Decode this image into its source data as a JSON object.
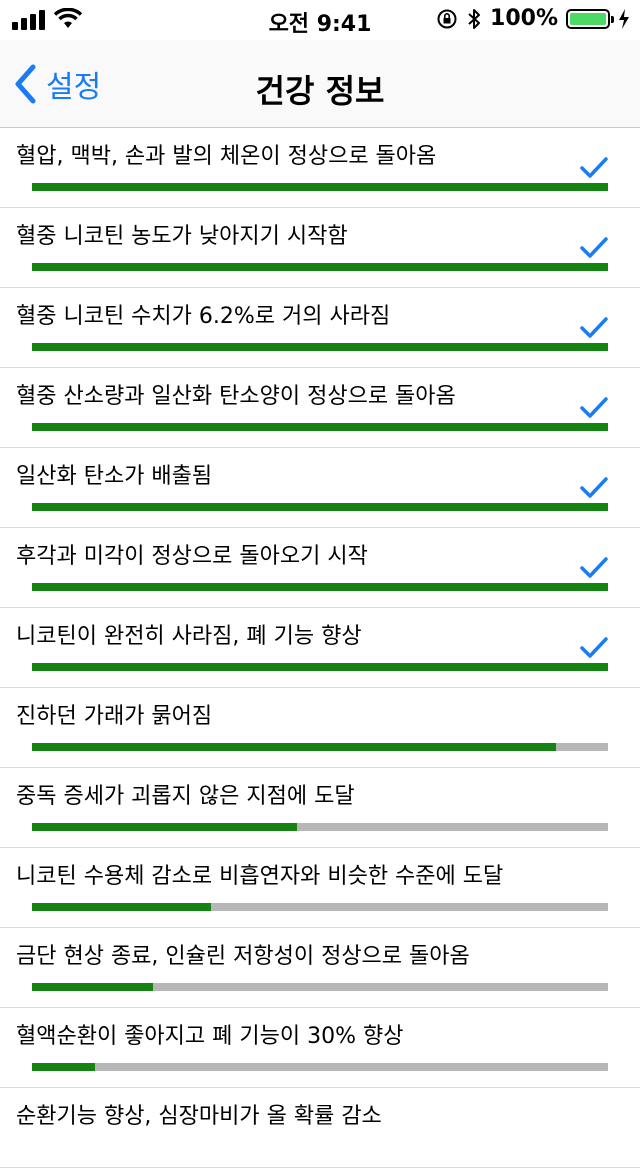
{
  "status_bar": {
    "time": "오전 9:41",
    "battery_text": "100%",
    "battery_level": 1.0,
    "icons": [
      "signal-icon",
      "wifi-icon",
      "orientation-lock-icon",
      "bluetooth-icon",
      "battery-icon",
      "charging-icon"
    ]
  },
  "nav": {
    "back_label": "설정",
    "title": "건강 정보"
  },
  "colors": {
    "accent": "#1a7cf5",
    "progress_fill": "#158412",
    "progress_track": "#b7b7b7"
  },
  "milestones": [
    {
      "label": "혈압, 맥박, 손과 발의 체온이 정상으로 돌아옴",
      "progress": 1.0,
      "done": true
    },
    {
      "label": "혈중 니코틴 농도가 낮아지기 시작함",
      "progress": 1.0,
      "done": true
    },
    {
      "label": "혈중 니코틴 수치가 6.2%로 거의 사라짐",
      "progress": 1.0,
      "done": true
    },
    {
      "label": "혈중 산소량과 일산화 탄소양이 정상으로 돌아옴",
      "progress": 1.0,
      "done": true
    },
    {
      "label": "일산화 탄소가 배출됨",
      "progress": 1.0,
      "done": true
    },
    {
      "label": "후각과 미각이 정상으로 돌아오기 시작",
      "progress": 1.0,
      "done": true
    },
    {
      "label": "니코틴이 완전히 사라짐, 폐 기능 향상",
      "progress": 1.0,
      "done": true
    },
    {
      "label": "진하던 가래가 묽어짐",
      "progress": 0.91,
      "done": false
    },
    {
      "label": "중독 증세가 괴롭지 않은 지점에 도달",
      "progress": 0.46,
      "done": false
    },
    {
      "label": "니코틴 수용체 감소로 비흡연자와 비슷한 수준에 도달",
      "progress": 0.31,
      "done": false
    },
    {
      "label": "금단 현상 종료, 인슐린 저항성이 정상으로 돌아옴",
      "progress": 0.21,
      "done": false
    },
    {
      "label": "혈액순환이 좋아지고 폐 기능이 30% 향상",
      "progress": 0.11,
      "done": false
    },
    {
      "label": "순환기능 향상, 심장마비가 올 확률 감소",
      "progress": null,
      "done": false
    }
  ]
}
